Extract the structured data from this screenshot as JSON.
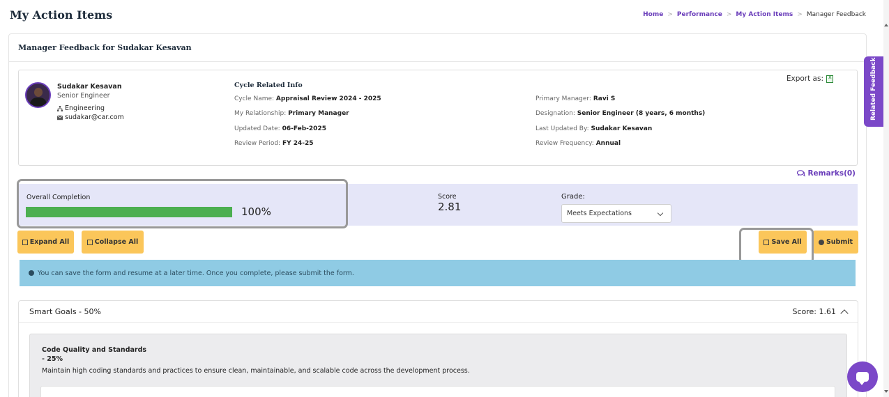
{
  "page": {
    "title": "My Action Items"
  },
  "breadcrumb": {
    "items": [
      "Home",
      "Performance",
      "My Action Items"
    ],
    "current": "Manager Feedback",
    "separator": ">"
  },
  "card": {
    "header": "Manager Feedback for Sudakar Kesavan"
  },
  "employee": {
    "name": "Sudakar Kesavan",
    "role": "Senior Engineer",
    "department": "Engineering",
    "email": "sudakar@car.com"
  },
  "cycle": {
    "title": "Cycle Related Info",
    "cycle_name_label": "Cycle Name:",
    "cycle_name": "Appraisal Review 2024 - 2025",
    "relationship_label": "My Relationship:",
    "relationship": "Primary Manager",
    "updated_date_label": "Updated Date:",
    "updated_date": "06-Feb-2025",
    "review_period_label": "Review Period:",
    "review_period": "FY 24-25",
    "primary_manager_label": "Primary Manager:",
    "primary_manager": "Ravi S",
    "designation_label": "Designation:",
    "designation": "Senior Engineer (8 years, 6 months)",
    "last_updated_by_label": "Last Updated By:",
    "last_updated_by": "Sudakar Kesavan",
    "review_frequency_label": "Review Frequency:",
    "review_frequency": "Annual"
  },
  "export": {
    "label": "Export as:",
    "icon": "excel-icon"
  },
  "remarks": {
    "label": "Remarks(0)"
  },
  "completion": {
    "label": "Overall Completion",
    "percent": 100,
    "percent_text": "100%",
    "score_label": "Score",
    "score_value": "2.81",
    "grade_label": "Grade:",
    "grade_selected": "Meets Expectations"
  },
  "buttons": {
    "expand_all": "Expand All",
    "collapse_all": "Collapse All",
    "save_all": "Save All",
    "submit": "Submit"
  },
  "alert": {
    "text": "You can save the form and resume at a later time. Once you complete, please submit the form."
  },
  "goals": {
    "title": "Smart Goals - 50%",
    "score": "Score: 1.61",
    "item": {
      "title": "Code Quality and Standards",
      "weight": "- 25%",
      "description": "Maintain high coding standards and practices to ensure clean, maintainable, and scalable code across the development process."
    }
  },
  "sidebar_tab": {
    "label": "Related Feedback"
  },
  "colors": {
    "accent": "#6a3dba",
    "button": "#fbc65a",
    "progress": "#4caf50",
    "alert": "#8fcbe4",
    "completion_bg": "#e5e6f8"
  }
}
